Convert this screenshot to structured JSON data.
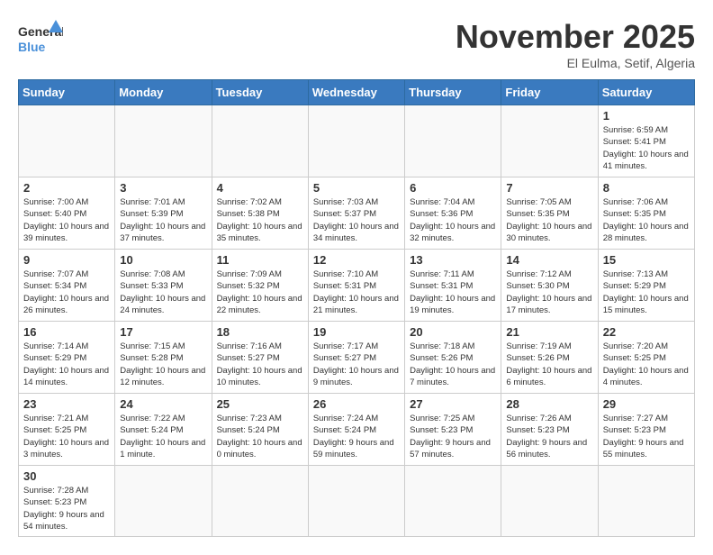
{
  "header": {
    "logo_general": "General",
    "logo_blue": "Blue",
    "title": "November 2025",
    "subtitle": "El Eulma, Setif, Algeria"
  },
  "days_of_week": [
    "Sunday",
    "Monday",
    "Tuesday",
    "Wednesday",
    "Thursday",
    "Friday",
    "Saturday"
  ],
  "weeks": [
    [
      {
        "day": null,
        "info": null
      },
      {
        "day": null,
        "info": null
      },
      {
        "day": null,
        "info": null
      },
      {
        "day": null,
        "info": null
      },
      {
        "day": null,
        "info": null
      },
      {
        "day": null,
        "info": null
      },
      {
        "day": "1",
        "info": "Sunrise: 6:59 AM\nSunset: 5:41 PM\nDaylight: 10 hours and 41 minutes."
      }
    ],
    [
      {
        "day": "2",
        "info": "Sunrise: 7:00 AM\nSunset: 5:40 PM\nDaylight: 10 hours and 39 minutes."
      },
      {
        "day": "3",
        "info": "Sunrise: 7:01 AM\nSunset: 5:39 PM\nDaylight: 10 hours and 37 minutes."
      },
      {
        "day": "4",
        "info": "Sunrise: 7:02 AM\nSunset: 5:38 PM\nDaylight: 10 hours and 35 minutes."
      },
      {
        "day": "5",
        "info": "Sunrise: 7:03 AM\nSunset: 5:37 PM\nDaylight: 10 hours and 34 minutes."
      },
      {
        "day": "6",
        "info": "Sunrise: 7:04 AM\nSunset: 5:36 PM\nDaylight: 10 hours and 32 minutes."
      },
      {
        "day": "7",
        "info": "Sunrise: 7:05 AM\nSunset: 5:35 PM\nDaylight: 10 hours and 30 minutes."
      },
      {
        "day": "8",
        "info": "Sunrise: 7:06 AM\nSunset: 5:35 PM\nDaylight: 10 hours and 28 minutes."
      }
    ],
    [
      {
        "day": "9",
        "info": "Sunrise: 7:07 AM\nSunset: 5:34 PM\nDaylight: 10 hours and 26 minutes."
      },
      {
        "day": "10",
        "info": "Sunrise: 7:08 AM\nSunset: 5:33 PM\nDaylight: 10 hours and 24 minutes."
      },
      {
        "day": "11",
        "info": "Sunrise: 7:09 AM\nSunset: 5:32 PM\nDaylight: 10 hours and 22 minutes."
      },
      {
        "day": "12",
        "info": "Sunrise: 7:10 AM\nSunset: 5:31 PM\nDaylight: 10 hours and 21 minutes."
      },
      {
        "day": "13",
        "info": "Sunrise: 7:11 AM\nSunset: 5:31 PM\nDaylight: 10 hours and 19 minutes."
      },
      {
        "day": "14",
        "info": "Sunrise: 7:12 AM\nSunset: 5:30 PM\nDaylight: 10 hours and 17 minutes."
      },
      {
        "day": "15",
        "info": "Sunrise: 7:13 AM\nSunset: 5:29 PM\nDaylight: 10 hours and 15 minutes."
      }
    ],
    [
      {
        "day": "16",
        "info": "Sunrise: 7:14 AM\nSunset: 5:29 PM\nDaylight: 10 hours and 14 minutes."
      },
      {
        "day": "17",
        "info": "Sunrise: 7:15 AM\nSunset: 5:28 PM\nDaylight: 10 hours and 12 minutes."
      },
      {
        "day": "18",
        "info": "Sunrise: 7:16 AM\nSunset: 5:27 PM\nDaylight: 10 hours and 10 minutes."
      },
      {
        "day": "19",
        "info": "Sunrise: 7:17 AM\nSunset: 5:27 PM\nDaylight: 10 hours and 9 minutes."
      },
      {
        "day": "20",
        "info": "Sunrise: 7:18 AM\nSunset: 5:26 PM\nDaylight: 10 hours and 7 minutes."
      },
      {
        "day": "21",
        "info": "Sunrise: 7:19 AM\nSunset: 5:26 PM\nDaylight: 10 hours and 6 minutes."
      },
      {
        "day": "22",
        "info": "Sunrise: 7:20 AM\nSunset: 5:25 PM\nDaylight: 10 hours and 4 minutes."
      }
    ],
    [
      {
        "day": "23",
        "info": "Sunrise: 7:21 AM\nSunset: 5:25 PM\nDaylight: 10 hours and 3 minutes."
      },
      {
        "day": "24",
        "info": "Sunrise: 7:22 AM\nSunset: 5:24 PM\nDaylight: 10 hours and 1 minute."
      },
      {
        "day": "25",
        "info": "Sunrise: 7:23 AM\nSunset: 5:24 PM\nDaylight: 10 hours and 0 minutes."
      },
      {
        "day": "26",
        "info": "Sunrise: 7:24 AM\nSunset: 5:24 PM\nDaylight: 9 hours and 59 minutes."
      },
      {
        "day": "27",
        "info": "Sunrise: 7:25 AM\nSunset: 5:23 PM\nDaylight: 9 hours and 57 minutes."
      },
      {
        "day": "28",
        "info": "Sunrise: 7:26 AM\nSunset: 5:23 PM\nDaylight: 9 hours and 56 minutes."
      },
      {
        "day": "29",
        "info": "Sunrise: 7:27 AM\nSunset: 5:23 PM\nDaylight: 9 hours and 55 minutes."
      }
    ],
    [
      {
        "day": "30",
        "info": "Sunrise: 7:28 AM\nSunset: 5:23 PM\nDaylight: 9 hours and 54 minutes."
      },
      {
        "day": null,
        "info": null
      },
      {
        "day": null,
        "info": null
      },
      {
        "day": null,
        "info": null
      },
      {
        "day": null,
        "info": null
      },
      {
        "day": null,
        "info": null
      },
      {
        "day": null,
        "info": null
      }
    ]
  ]
}
